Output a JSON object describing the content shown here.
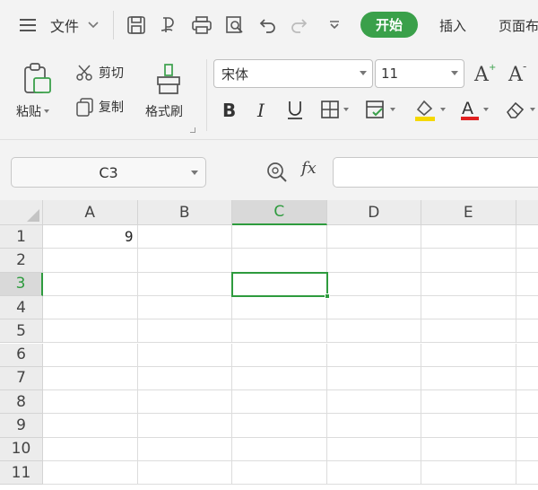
{
  "menu": {
    "file_label": "文件",
    "tabs": [
      {
        "label": "开始",
        "active": true
      },
      {
        "label": "插入",
        "active": false
      },
      {
        "label": "页面布"
      }
    ]
  },
  "ribbon": {
    "cut_label": "剪切",
    "copy_label": "复制",
    "paste_label": "粘贴",
    "format_painter_label": "格式刷",
    "font_name": "宋体",
    "font_size": "11",
    "accent_color": "#3aa04a",
    "font_color": "#e02020",
    "fill_color": "#f5d800"
  },
  "formula_bar": {
    "name_box": "C3",
    "fx_label": "fx",
    "formula_value": ""
  },
  "sheet": {
    "columns": [
      "A",
      "B",
      "C",
      "D",
      "E"
    ],
    "rows": [
      "1",
      "2",
      "3",
      "4",
      "5",
      "6",
      "7",
      "8",
      "9",
      "10",
      "11"
    ],
    "active_cell": "C3",
    "cells": {
      "A1": "9"
    }
  }
}
